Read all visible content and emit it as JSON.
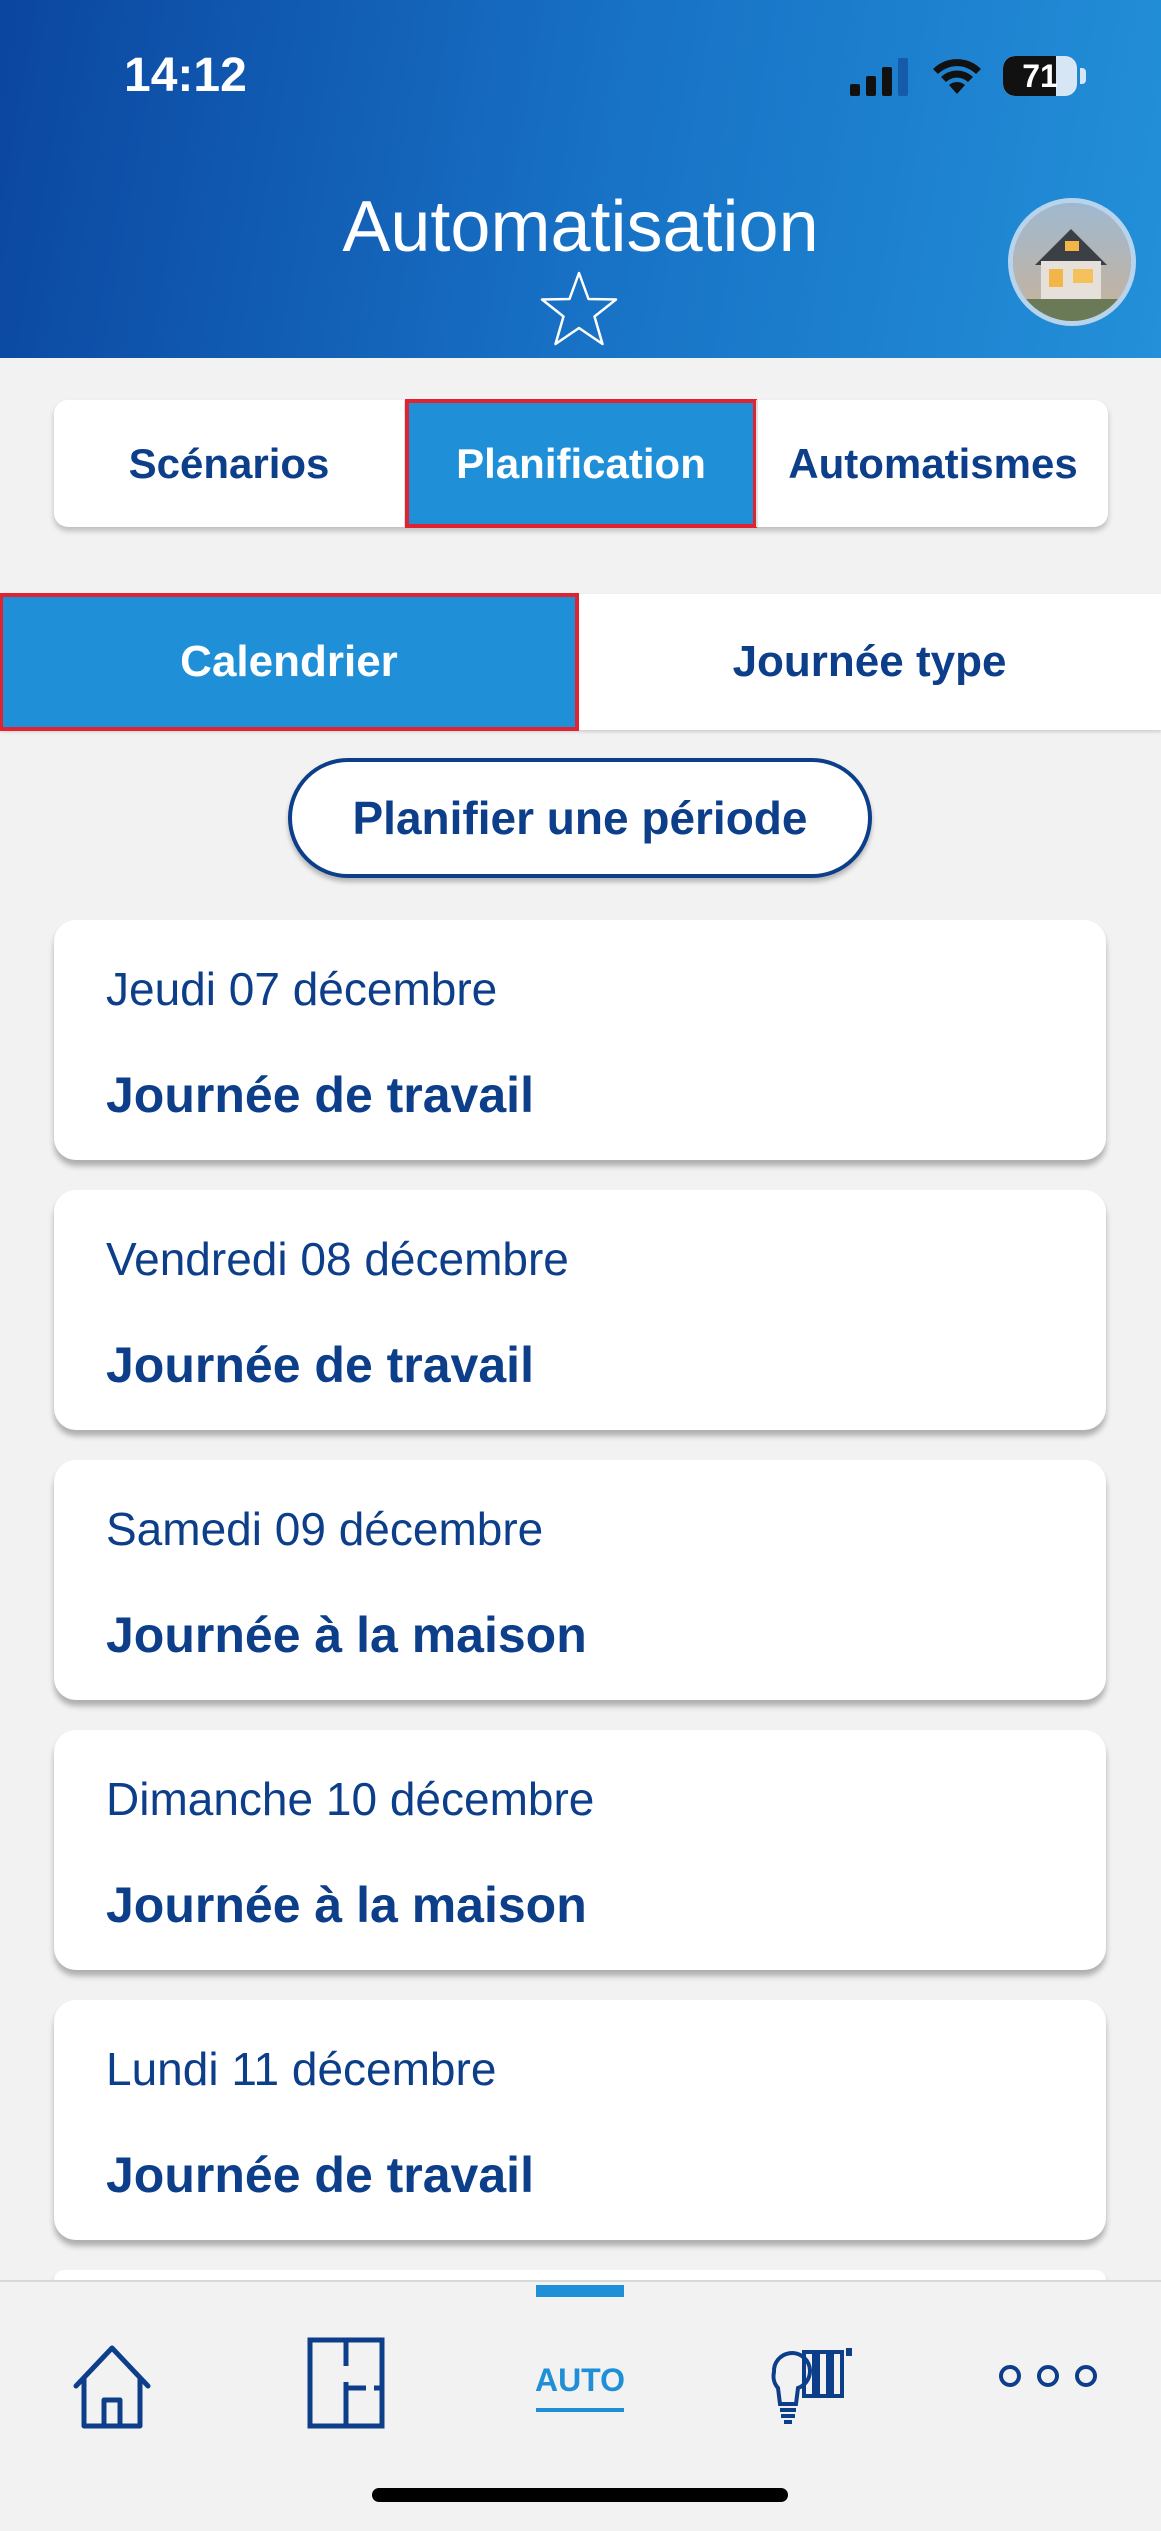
{
  "status_bar": {
    "time": "14:12",
    "battery": "71",
    "battery_level": 0.71
  },
  "header": {
    "title": "Automatisation"
  },
  "segments": [
    {
      "label": "Scénarios",
      "active": false
    },
    {
      "label": "Planification",
      "active": true
    },
    {
      "label": "Automatismes",
      "active": false
    }
  ],
  "subtabs": [
    {
      "label": "Calendrier",
      "active": true
    },
    {
      "label": "Journée type",
      "active": false
    }
  ],
  "plan_button": {
    "label": "Planifier une période"
  },
  "days": [
    {
      "date": "Jeudi 07 décembre",
      "type": "Journée de travail"
    },
    {
      "date": "Vendredi 08 décembre",
      "type": "Journée de travail"
    },
    {
      "date": "Samedi 09 décembre",
      "type": "Journée à la maison"
    },
    {
      "date": "Dimanche 10 décembre",
      "type": "Journée à la maison"
    },
    {
      "date": "Lundi 11 décembre",
      "type": "Journée de travail"
    }
  ],
  "bottom_nav": [
    {
      "icon": "home-icon",
      "active": false
    },
    {
      "icon": "floor-plan-icon",
      "active": false
    },
    {
      "label": "AUTO",
      "active": true
    },
    {
      "icon": "lighting-shutters-icon",
      "active": false
    },
    {
      "icon": "more-icon",
      "active": false
    }
  ],
  "colors": {
    "primary": "#0d3e8a",
    "accent": "#1f8fd7",
    "highlight": "#e02330"
  }
}
